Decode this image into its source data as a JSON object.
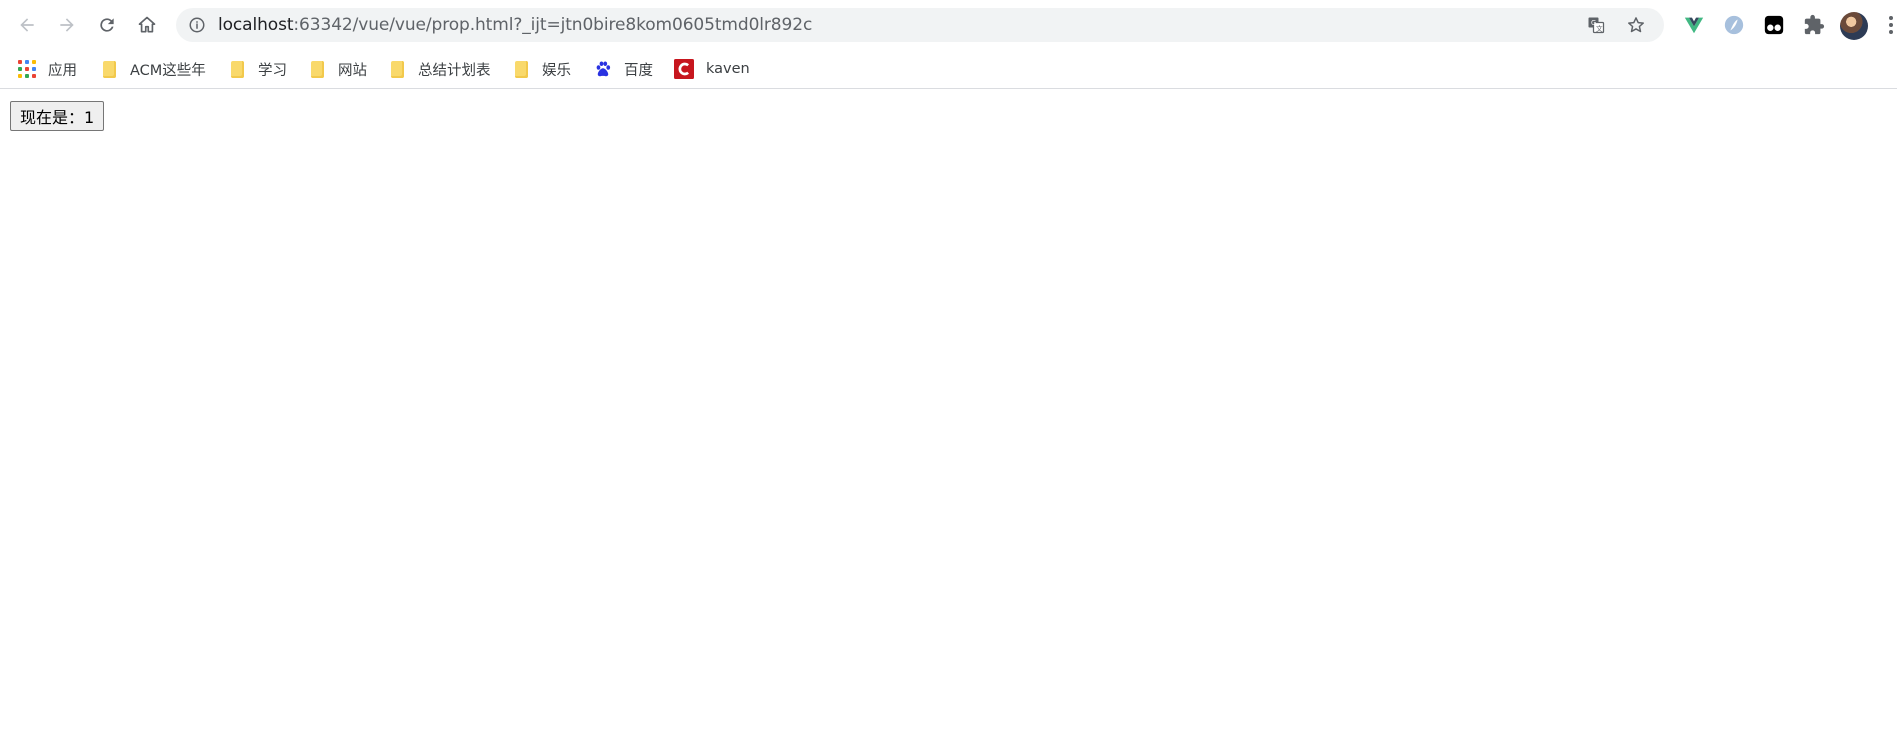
{
  "browser": {
    "url_host": "localhost",
    "url_rest": ":63342/vue/vue/prop.html?_ijt=jtn0bire8kom0605tmd0lr892c",
    "back_icon": "arrow-left-icon",
    "forward_icon": "arrow-right-icon",
    "reload_icon": "reload-icon",
    "home_icon": "home-icon",
    "info_icon": "info-icon",
    "translate_icon": "translate-icon",
    "star_icon": "star-icon",
    "extensions": [
      "vue-devtools-icon",
      "profile-icon",
      "tampermonkey-icon",
      "puzzle-icon"
    ],
    "accent": "#1a73e8"
  },
  "bookmarks": [
    {
      "label": "应用",
      "icon": "apps-grid-icon"
    },
    {
      "label": "ACM这些年",
      "icon": "folder-icon"
    },
    {
      "label": "学习",
      "icon": "folder-icon"
    },
    {
      "label": "网站",
      "icon": "folder-icon"
    },
    {
      "label": "总结计划表",
      "icon": "folder-icon"
    },
    {
      "label": "娱乐",
      "icon": "folder-icon"
    },
    {
      "label": "百度",
      "icon": "baidu-paw-icon"
    },
    {
      "label": "kaven",
      "icon": "kaven-c-icon"
    }
  ],
  "page": {
    "counter_button_label": "现在是：1"
  }
}
